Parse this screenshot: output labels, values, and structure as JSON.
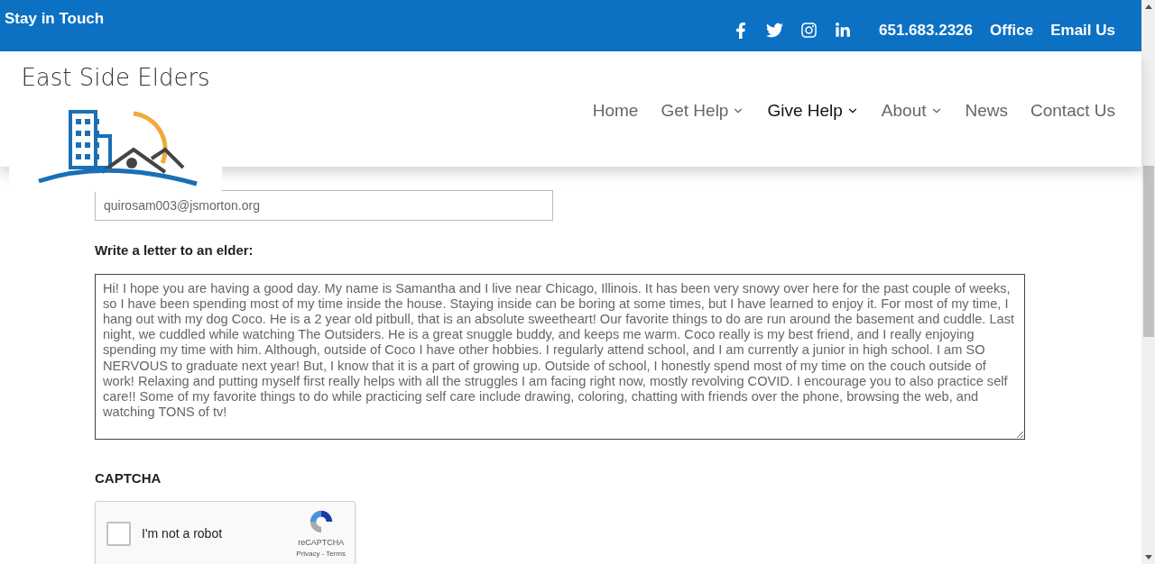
{
  "top_bar": {
    "title": "Stay in Touch",
    "phone": "651.683.2326",
    "links": [
      "Office",
      "Email Us"
    ]
  },
  "logo": {
    "text": "East Side Elders"
  },
  "nav": [
    {
      "label": "Home",
      "selected": false,
      "dropdown": false
    },
    {
      "label": "Get Help",
      "selected": false,
      "dropdown": true
    },
    {
      "label": "Give Help",
      "selected": true,
      "dropdown": true
    },
    {
      "label": "About",
      "selected": false,
      "dropdown": true
    },
    {
      "label": "News",
      "selected": false,
      "dropdown": false
    },
    {
      "label": "Contact Us",
      "selected": false,
      "dropdown": false
    }
  ],
  "form": {
    "email": {
      "value": "quirosam003@jsmorton.org"
    },
    "letter": {
      "label": "Write a letter to an elder:",
      "value": "Hi! I hope you are having a good day. My name is Samantha and I live near Chicago, Illinois. It has been very snowy over here for the past couple of weeks, so I have been spending most of my time inside the house. Staying inside can be boring at some times, but I have learned to enjoy it. For most of my time, I hang out with my dog Coco. He is a 2 year old pitbull, that is an absolute sweetheart! Our favorite things to do are run around the basement and cuddle. Last night, we cuddled while watching The Outsiders. He is a great snuggle buddy, and keeps me warm. Coco really is my best friend, and I really enjoying spending my time with him. Although, outside of Coco I have other hobbies. I regularly attend school, and I am currently a junior in high school. I am SO NERVOUS to graduate next year! But, I know that it is a part of growing up. Outside of school, I honestly spend most of my time on the couch outside of work! Relaxing and putting myself first really helps with all the struggles I am facing right now, mostly revolving COVID. I encourage you to also practice self care!! Some of my favorite things to do while practicing self care include drawing, coloring, chatting with friends over the phone, browsing the web, and watching TONS of tv!"
    },
    "captcha": {
      "label": "CAPTCHA",
      "checkbox_label": "I'm not a robot",
      "checked": false,
      "brand": "reCAPTCHA",
      "privacy": "Privacy",
      "separator": "-",
      "terms": "Terms"
    }
  }
}
